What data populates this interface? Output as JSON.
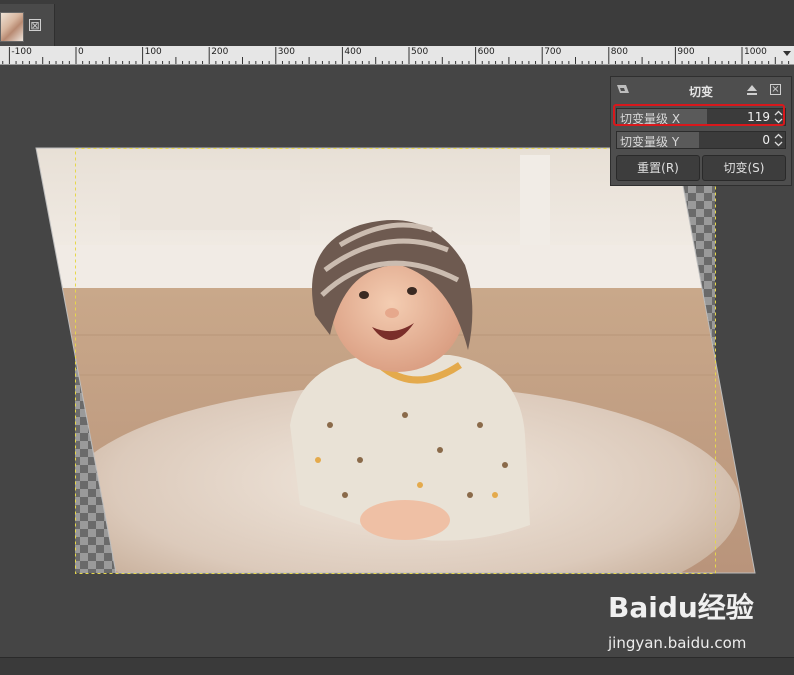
{
  "tab": {
    "close_symbol": "⊠",
    "thumbnail_icon": "image-thumbnail"
  },
  "ruler": {
    "labels": [
      "-100",
      "0",
      "100",
      "200",
      "300",
      "400",
      "500",
      "600",
      "700",
      "800",
      "900",
      "1000"
    ],
    "scale": "pixels"
  },
  "dialog": {
    "title": "切变",
    "tool_icon": "shear-tool-icon",
    "eject_icon": "eject-icon",
    "close_icon": "close-icon",
    "shear_x": {
      "label": "切变量级 X",
      "value": "119"
    },
    "shear_y": {
      "label": "切变量级 Y",
      "value": "0"
    },
    "reset_label": "重置(R)",
    "shear_label": "切变(S)"
  },
  "watermark": {
    "brand": "Baidu经验",
    "url": "jingyan.baidu.com"
  },
  "colors": {
    "canvas_bg": "#454545",
    "ruler_bg": "#e6e6e6",
    "dialog_bg": "#4e4e4e",
    "highlight": "#d8181c",
    "selection": "#e6d84a"
  }
}
